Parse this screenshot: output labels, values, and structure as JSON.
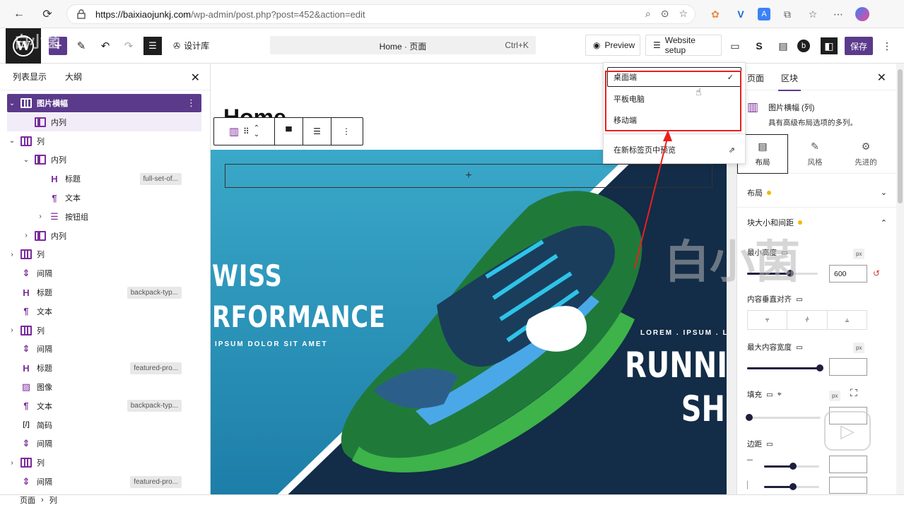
{
  "browser": {
    "url_host": "https://baixiaojunkj.com",
    "url_path": "/wp-admin/post.php?post=452&action=edit"
  },
  "toolbar": {
    "design_label": "设计库",
    "command_title": "Home · 页面",
    "command_shortcut": "Ctrl+K",
    "preview_label": "Preview",
    "website_setup_label": "Website setup",
    "save_label": "保存"
  },
  "preview_menu": {
    "items": [
      "桌面端",
      "平板电脑",
      "移动端"
    ],
    "check": "✓",
    "open_new_tab": "在新标签页中预览"
  },
  "left_panel": {
    "tabs": [
      "列表显示",
      "大纲"
    ],
    "rows": [
      {
        "label": "图片横幅",
        "tag": ""
      },
      {
        "label": "内列",
        "tag": ""
      },
      {
        "label": "列",
        "tag": ""
      },
      {
        "label": "内列",
        "tag": ""
      },
      {
        "label": "标题",
        "tag": "full-set-of..."
      },
      {
        "label": "文本",
        "tag": ""
      },
      {
        "label": "按钮组",
        "tag": ""
      },
      {
        "label": "内列",
        "tag": ""
      },
      {
        "label": "列",
        "tag": ""
      },
      {
        "label": "间隔",
        "tag": ""
      },
      {
        "label": "标题",
        "tag": "backpack-typ..."
      },
      {
        "label": "文本",
        "tag": ""
      },
      {
        "label": "列",
        "tag": ""
      },
      {
        "label": "间隔",
        "tag": ""
      },
      {
        "label": "标题",
        "tag": "featured-pro..."
      },
      {
        "label": "图像",
        "tag": ""
      },
      {
        "label": "文本",
        "tag": "backpack-typ..."
      },
      {
        "label": "简码",
        "tag": ""
      },
      {
        "label": "间隔",
        "tag": ""
      },
      {
        "label": "列",
        "tag": ""
      },
      {
        "label": "间隔",
        "tag": "featured-pro..."
      }
    ],
    "breadcrumb": [
      "页面",
      "列"
    ]
  },
  "canvas": {
    "heading": "Home",
    "insert_symbol": "+",
    "hero_line1": "WISS",
    "hero_line2": "RFORMANCE",
    "hero_sub": "IPSUM DOLOR SIT AMET",
    "hero_lorem": "LOREM . IPSUM . L",
    "hero_line3": "RUNNIN",
    "hero_line4": "SHO"
  },
  "right_panel": {
    "tabs": [
      "页面",
      "区块"
    ],
    "block_title": "图片横幅 (列)",
    "block_desc": "具有高级布局选项的多列。",
    "subtabs": [
      "布局",
      "风格",
      "先进的"
    ],
    "section_layout": "布局",
    "section_size": "块大小和间距",
    "min_height_label": "最小高度",
    "min_height_value": "600",
    "unit": "px",
    "vertical_align_label": "内容垂直对齐",
    "max_width_label": "最大内容宽度",
    "padding_label": "填充",
    "margin_label": "边距"
  },
  "watermark": "白小菌",
  "colors": {
    "accent": "#5b3a8c",
    "highlight": "#e8201e",
    "hero_blue": "#2a95bf",
    "hero_dark": "#132c47"
  }
}
